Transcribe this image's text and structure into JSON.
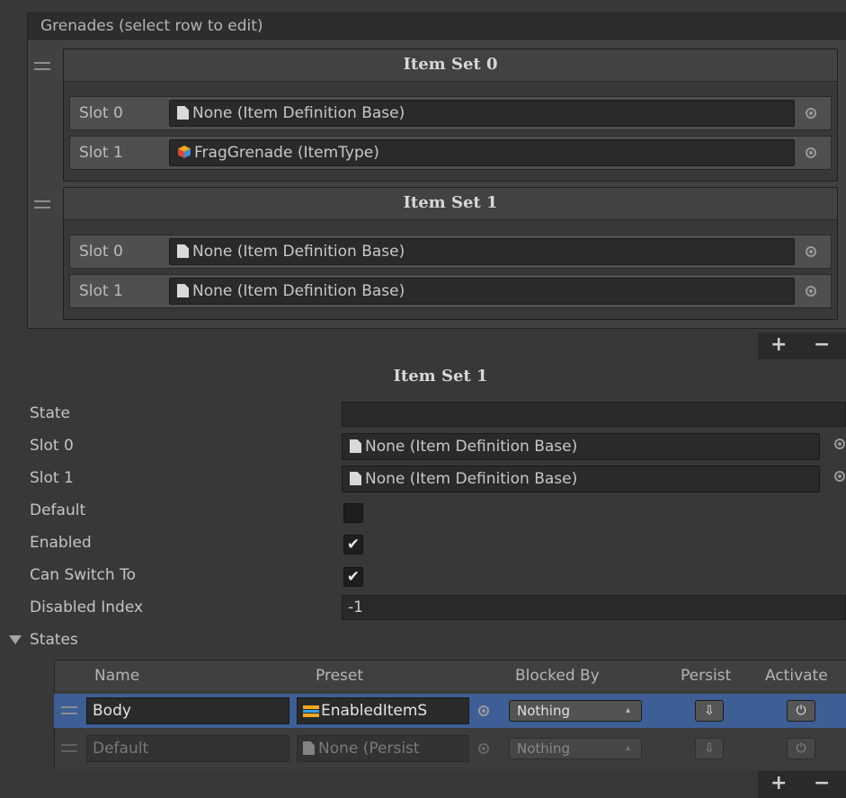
{
  "list": {
    "header": "Grenades (select row to edit)",
    "item_sets": [
      {
        "title": "Item Set 0",
        "slots": [
          {
            "label": "Slot 0",
            "value": "None (Item Definition Base)",
            "icon": "document-icon"
          },
          {
            "label": "Slot 1",
            "value": "FragGrenade (ItemType)",
            "icon": "cube-icon"
          }
        ]
      },
      {
        "title": "Item Set 1",
        "slots": [
          {
            "label": "Slot 0",
            "value": "None (Item Definition Base)",
            "icon": "document-icon"
          },
          {
            "label": "Slot 1",
            "value": "None (Item Definition Base)",
            "icon": "document-icon"
          }
        ]
      }
    ],
    "add_label": "+",
    "remove_label": "−"
  },
  "detail": {
    "title": "Item Set 1",
    "state_label": "State",
    "state_value": "",
    "slot0_label": "Slot 0",
    "slot0_value": "None (Item Definition Base)",
    "slot1_label": "Slot 1",
    "slot1_value": "None (Item Definition Base)",
    "default_label": "Default",
    "default_checked": false,
    "enabled_label": "Enabled",
    "enabled_checked": true,
    "can_switch_label": "Can Switch To",
    "can_switch_checked": true,
    "disabled_index_label": "Disabled Index",
    "disabled_index_value": "-1"
  },
  "states": {
    "foldout_label": "States",
    "columns": [
      "Name",
      "Preset",
      "Blocked By",
      "Persist",
      "Activate"
    ],
    "rows": [
      {
        "name": "Body",
        "preset": "EnabledItemS",
        "blocked_by": "Nothing",
        "selected": true
      },
      {
        "name": "Default",
        "preset": "None (Persist",
        "blocked_by": "Nothing",
        "selected": false
      }
    ],
    "add_label": "+",
    "remove_label": "−"
  },
  "colors": {
    "selection": "#3e5f96",
    "panel": "#383838",
    "field": "#2a2a2a"
  }
}
